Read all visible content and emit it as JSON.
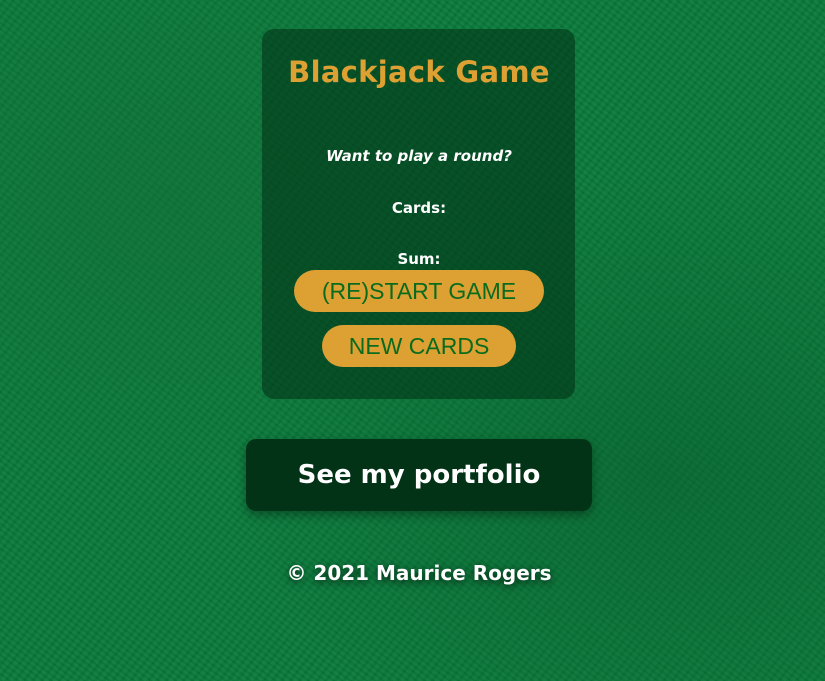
{
  "game": {
    "title": "Blackjack Game",
    "message": "Want to play a round?",
    "cards_label": "Cards:",
    "sum_label": "Sum:"
  },
  "buttons": {
    "restart_label": "(RE)START GAME",
    "new_cards_label": "NEW CARDS"
  },
  "portfolio_link": {
    "label": "See my portfolio"
  },
  "footer": {
    "copyright": "© 2021 Maurice Rogers"
  },
  "colors": {
    "felt_green": "#0a7a3b",
    "panel": "#00361a",
    "accent_gold": "#dca033",
    "button_text_green": "#0a6b1e",
    "portfolio_bg": "#033316"
  }
}
